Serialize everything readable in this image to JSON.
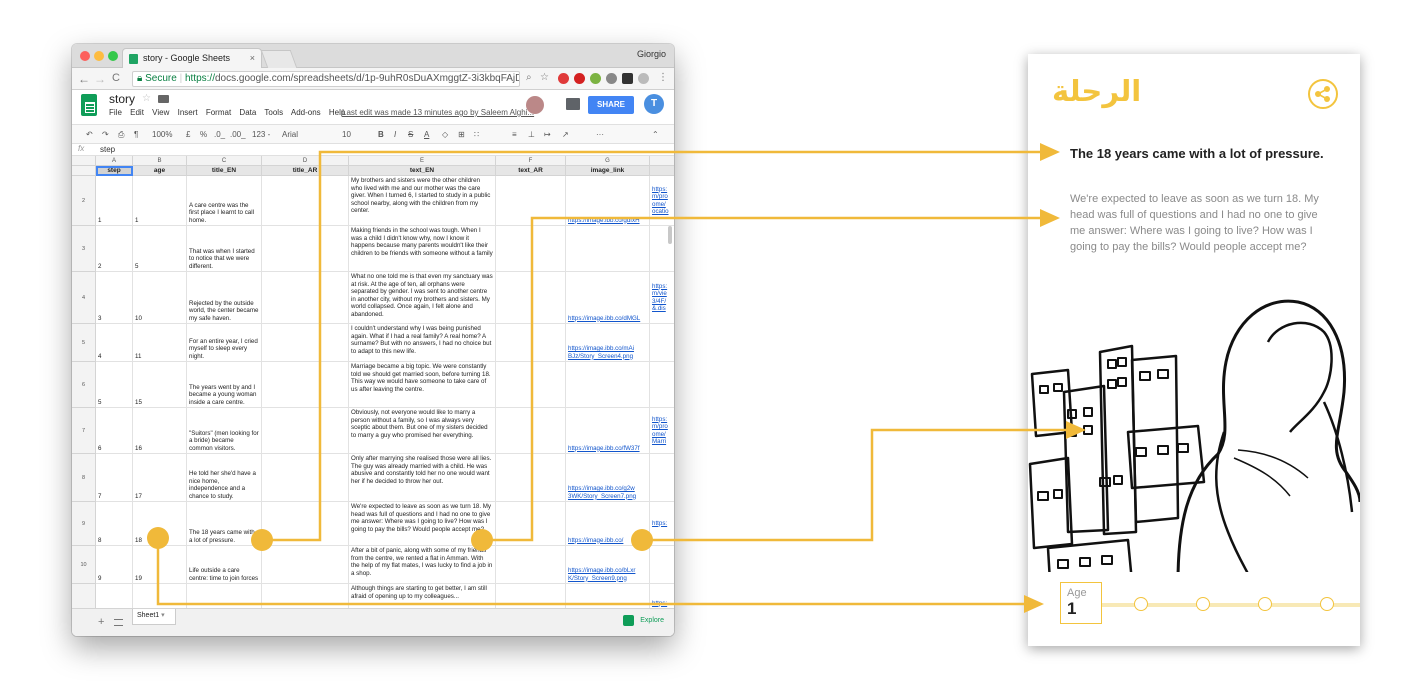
{
  "browser": {
    "tab_title": "story - Google Sheets",
    "tab_close": "×",
    "profile": "Giorgio",
    "nav": {
      "back": "←",
      "forward": "→",
      "reload": "C"
    },
    "secure_label": "Secure",
    "url_https": "https://",
    "url_rest": "docs.google.com/spreadsheets/d/1p-9uhR0sDuAXmggtZ-3i3kbqFAjDSmQSD...",
    "url_icons": [
      "zoom-icon",
      "star-icon"
    ]
  },
  "sheets": {
    "doc_name": "story",
    "menu": [
      "File",
      "Edit",
      "View",
      "Insert",
      "Format",
      "Data",
      "Tools",
      "Add-ons",
      "Help"
    ],
    "last_edit": "Last edit was made 13 minutes ago by Saleem Alghi...",
    "share_label": "SHARE",
    "user_initial": "T",
    "toolbar": {
      "zoom": "100%",
      "currency": "£",
      "percent": "%",
      "dec_less": ".0_",
      "dec_more": ".00_",
      "format_123": "123 -",
      "font": "Arial",
      "size": "10",
      "bold": "B",
      "italic": "I",
      "strike": "S",
      "underline": "A",
      "more": "···"
    },
    "fx_label": "fx",
    "formula_value": "step",
    "col_letters": [
      "A",
      "B",
      "C",
      "D",
      "E",
      "F",
      "G",
      ""
    ],
    "headers": [
      "step",
      "age",
      "title_EN",
      "title_AR",
      "text_EN",
      "text_AR",
      "image_link",
      ""
    ],
    "rows": [
      {
        "num": "2",
        "step": "1",
        "age": "1",
        "title": "A care centre was the first place I learnt to call home.",
        "text": "My brothers and sisters were the other children who lived with me and our mother was the care giver. When I turned 6, I started to study in a public school nearby, along with the children from my center.",
        "link": "https://image.ibb.co/gdfxH",
        "extra": "https: m/pro ome/ ocatio"
      },
      {
        "num": "3",
        "step": "2",
        "age": "5",
        "title": "That was when I started to notice that we were different.",
        "text": "Making friends in the school was tough. When I was a child I didn't know why, now I know it happens because many parents wouldn't like their children to be friends with someone without a family",
        "link": "",
        "extra": ""
      },
      {
        "num": "4",
        "step": "3",
        "age": "10",
        "title": "Rejected by the outside world, the center became my safe haven.",
        "text": "What no one told me is that even my sanctuary was at risk. At the age of ten, all orphans were separated by gender. I was sent to another centre in another city, without my brothers and sisters. My world collapsed. Once again, I felt alone and abandoned.",
        "link": "https://image.ibb.co/dMGL",
        "extra": "https: m/vie 3/4F/ &.dis"
      },
      {
        "num": "5",
        "step": "4",
        "age": "11",
        "title": "For an entire year, I cried myself to sleep every night.",
        "text": "I couldn't understand why I was being punished again. What if I had a real family? A real home? A surname? But with no answers, I had no choice but to adapt to this new life.",
        "link": "https://image.ibb.co/mAi BJz/Story_Screen4.png",
        "extra": ""
      },
      {
        "num": "6",
        "step": "5",
        "age": "15",
        "title": "The years went by and I became a young woman inside a care centre.",
        "text": "Marriage became a big topic. We were constantly told we should get married soon, before turning 18. This way we would have someone to take care of us after leaving the centre.",
        "link": "",
        "extra": ""
      },
      {
        "num": "7",
        "step": "6",
        "age": "16",
        "title": "\"Suitors\" (men looking for a bride) became common visitors.",
        "text": "Obviously, not everyone would like to marry a person without a family, so I was always very sceptic about them. But one of my sisters decided to marry a guy who promised her everything.",
        "link": "https://image.ibb.co/fW37f",
        "extra": "https: m/pro ome/ Marri"
      },
      {
        "num": "8",
        "step": "7",
        "age": "17",
        "title": "He told her she'd have a nice home, independence and a chance to study.",
        "text": "Only after marrying she realised those were all lies. The guy was already married with a child. He was abusive and constantly told her no one would want her if he decided to throw her out.",
        "link": "https://image.ibb.co/g2w 3WK/Story_Screen7.png",
        "extra": ""
      },
      {
        "num": "9",
        "step": "8",
        "age": "18",
        "title": "The 18 years came with a lot of pressure.",
        "text": "We're expected to leave as soon as we turn 18. My head was full of questions and I had no one to give me answer: Where was I going to live? How was I going to pay the bills? Would people accept me?",
        "link": "https://image.ibb.co/",
        "extra": "https:"
      },
      {
        "num": "10",
        "step": "9",
        "age": "19",
        "title": "Life outside a care centre: time to join forces",
        "text": "After a bit of panic, along with some of my friends from the centre, we rented a flat in Amman. With the help of my flat mates, I was lucky to find a job in a shop.",
        "link": "https://image.ibb.co/bLxr K/Story_Screen9.png",
        "extra": ""
      },
      {
        "num": "",
        "step": "",
        "age": "",
        "title": "",
        "text": "Although things are starting to get better, I am still afraid of opening up to my colleagues...",
        "link": "",
        "extra": "https:"
      }
    ],
    "sheet_tab": "Sheet1",
    "explore": "Explore"
  },
  "app": {
    "title": "الرحلة",
    "heading": "The 18 years came with a lot of pressure.",
    "body": "We're expected to leave as soon as we turn 18. My head was full of questions and I had no one to give me answer: Where was I going to live? How was I going to pay the bills? Would people accept me?",
    "age_label": "Age",
    "age_value": "1"
  },
  "colors": {
    "accent": "#f3c43e",
    "sheets_green": "#0f9d58",
    "share_blue": "#4285f4"
  }
}
